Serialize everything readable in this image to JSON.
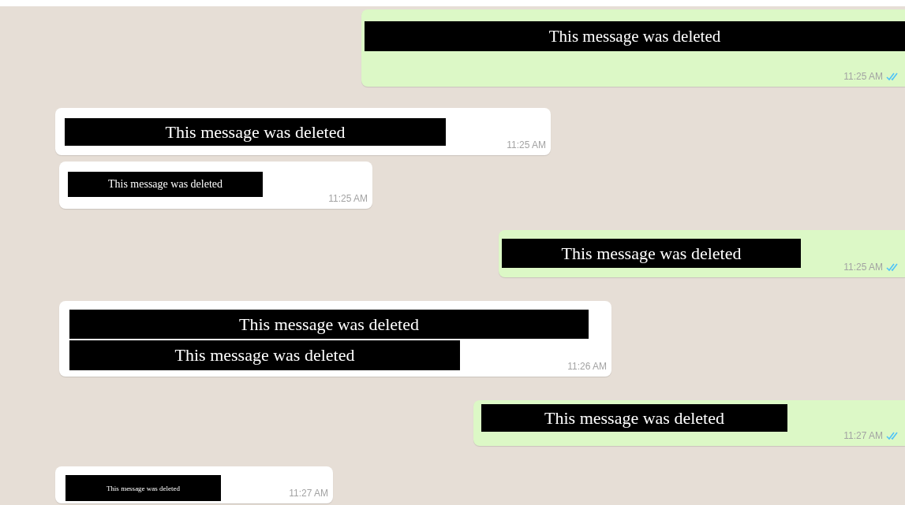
{
  "messages": [
    {
      "outgoing": true,
      "lines": [
        "This message was deleted"
      ],
      "time": "11:25 AM",
      "read": true
    },
    {
      "outgoing": false,
      "lines": [
        "This message was deleted"
      ],
      "time": "11:25 AM"
    },
    {
      "outgoing": false,
      "lines": [
        "This message was deleted"
      ],
      "time": "11:25 AM"
    },
    {
      "outgoing": true,
      "lines": [
        "This message was deleted"
      ],
      "time": "11:25 AM",
      "read": true
    },
    {
      "outgoing": false,
      "lines": [
        "This message was deleted",
        "This message was deleted"
      ],
      "time": "11:26 AM"
    },
    {
      "outgoing": true,
      "lines": [
        "This message was deleted"
      ],
      "time": "11:27 AM",
      "read": true
    },
    {
      "outgoing": false,
      "lines": [
        "This message was deleted"
      ],
      "time": "11:27 AM"
    }
  ]
}
